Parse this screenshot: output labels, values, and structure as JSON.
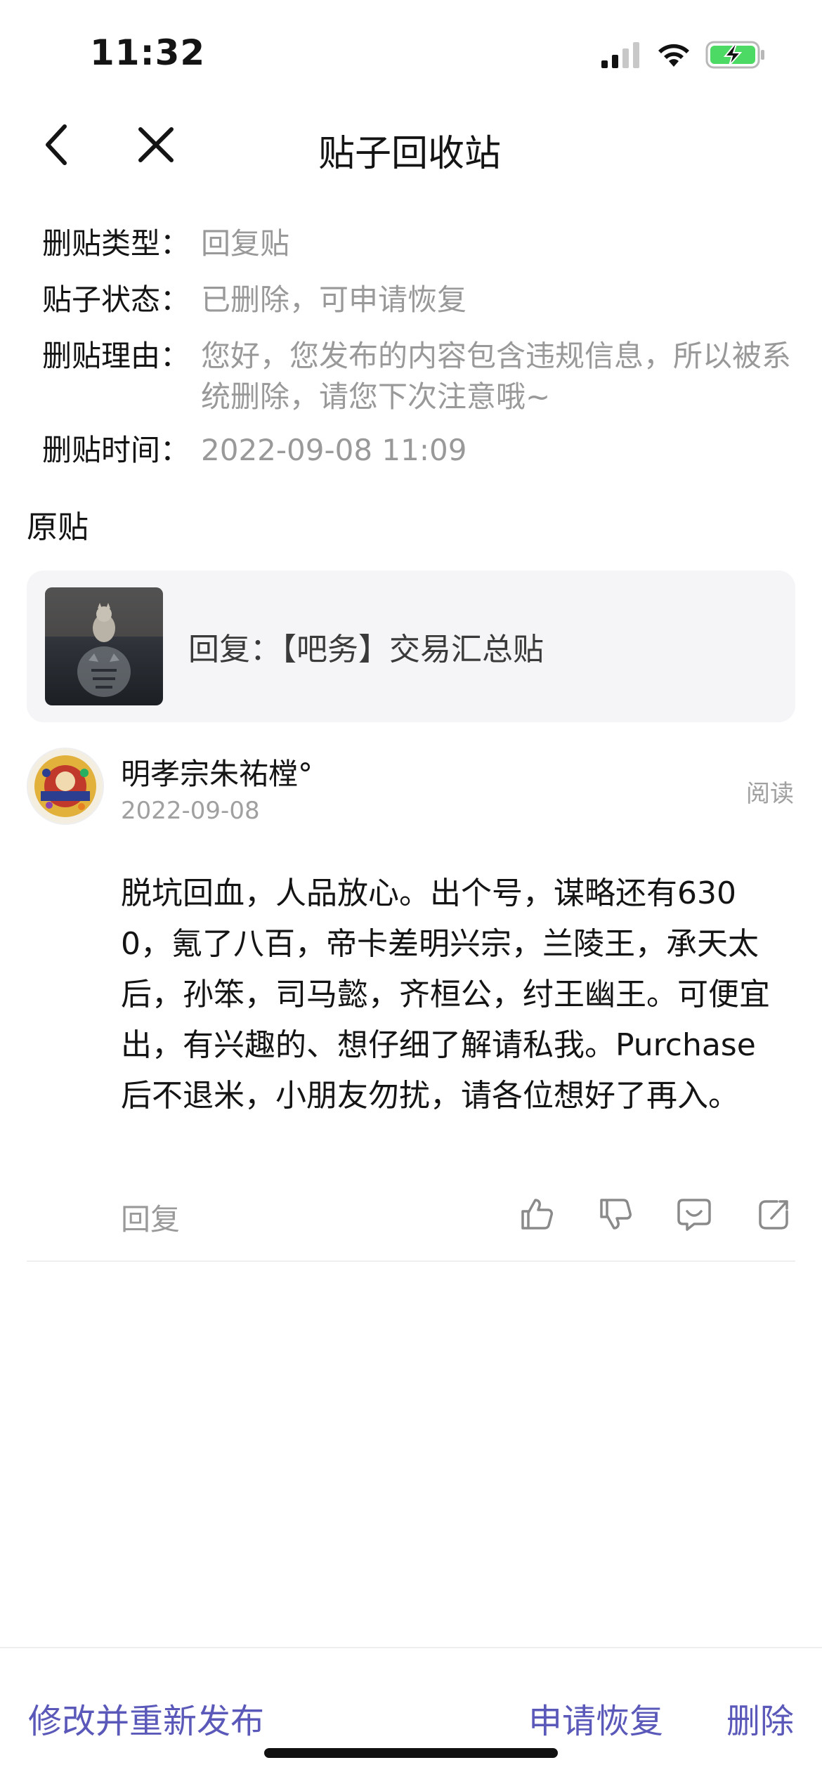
{
  "status_bar": {
    "time": "11:32",
    "icons": [
      "cellular-signal-icon",
      "wifi-icon",
      "battery-charging-icon"
    ],
    "battery_color": "#4cd964"
  },
  "nav": {
    "title": "贴子回收站",
    "back_icon": "chevron-left-icon",
    "close_icon": "close-icon"
  },
  "info": [
    {
      "key": "删贴类型：",
      "value": "回复贴"
    },
    {
      "key": "贴子状态：",
      "value": "已删除，可申请恢复"
    },
    {
      "key": "删贴理由：",
      "value": "您好，您发布的内容包含违规信息，所以被系统删除，请您下次注意哦~"
    },
    {
      "key": "删贴时间：",
      "value": "2022-09-08 11:09"
    }
  ],
  "original": {
    "label": "原贴",
    "text": "回复：【吧务】交易汇总贴"
  },
  "post": {
    "author": "明孝宗朱祐樘°",
    "date": "2022-09-08",
    "read_label": "阅读",
    "body": " 脱坑回血，人品放心。出个号，谋略还有6300，氪了八百，帝卡差明兴宗，兰陵王，承天太后，孙笨，司马懿，齐桓公，纣王幽王。可便宜出，有兴趣的、想仔细了解请私我。Purchase后不退米，小朋友勿扰，请各位想好了再入。",
    "reply_label": "回复",
    "action_icons": [
      "thumbs-up-icon",
      "thumbs-down-icon",
      "comment-icon",
      "share-icon"
    ]
  },
  "bottom": {
    "republish_label": "修改并重新发布",
    "restore_label": "申请恢复",
    "delete_label": "删除",
    "accent_color": "#5a58b8"
  }
}
